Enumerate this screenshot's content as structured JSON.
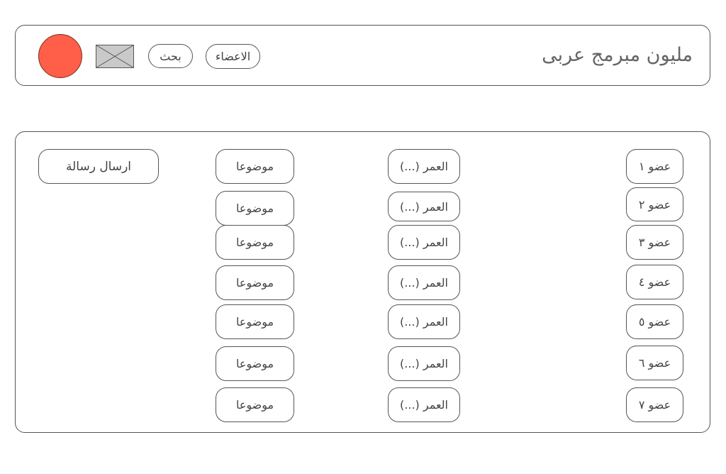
{
  "header": {
    "site_title": "مليون مبرمج عربى",
    "nav": {
      "members_label": "الاعضاء",
      "search_label": "بحث"
    },
    "avatar_color": "#FF5F49"
  },
  "main": {
    "send_message_label": "ارسال رسالة",
    "rows": [
      {
        "member": "عضو ١",
        "age": "العمر (...)",
        "topic": "موضوعا"
      },
      {
        "member": "عضو ٢",
        "age": "العمر (...)",
        "topic": "موضوعا"
      },
      {
        "member": "عضو ٣",
        "age": "العمر (...)",
        "topic": "موضوعا"
      },
      {
        "member": "عضو ٤",
        "age": "العمر (...)",
        "topic": "موضوعا"
      },
      {
        "member": "عضو ٥",
        "age": "العمر (...)",
        "topic": "موضوعا"
      },
      {
        "member": "عضو ٦",
        "age": "العمر (...)",
        "topic": "موضوعا"
      },
      {
        "member": "عضو ٧",
        "age": "العمر (...)",
        "topic": "موضوعا"
      }
    ]
  }
}
